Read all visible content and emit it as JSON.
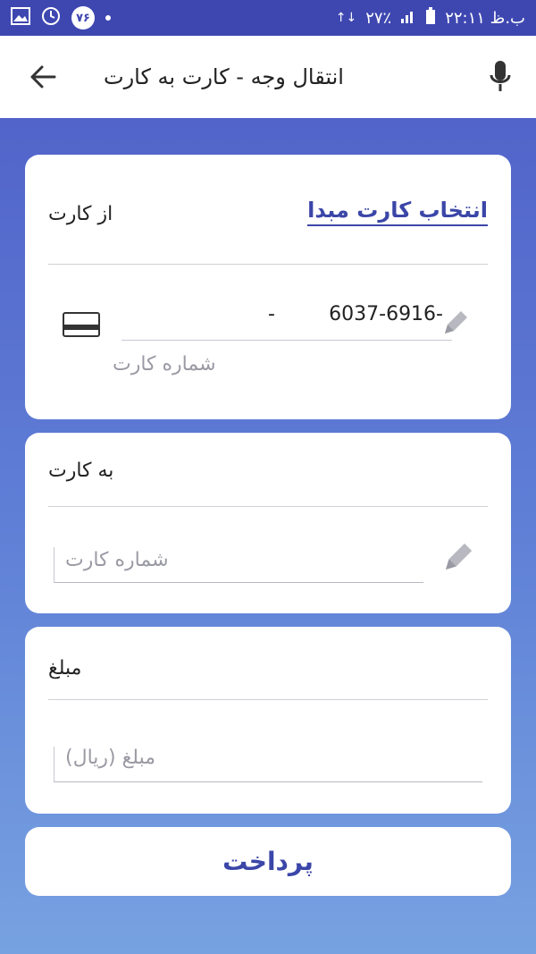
{
  "status_bar": {
    "left_time": "ب.ظ ۲۲:۱۱",
    "battery": "۲۷٪",
    "notification_badge": "۷۶"
  },
  "header": {
    "title": "انتقال وجه - کارت به کارت"
  },
  "card_source": {
    "label": "از کارت",
    "select_link": "انتخاب کارت مبدا",
    "number_left": "-",
    "number_right": "6037-6916-",
    "hint": "شماره کارت"
  },
  "card_dest": {
    "label": "به کارت",
    "placeholder": "شماره کارت"
  },
  "amount": {
    "label": "مبلغ",
    "placeholder": "مبلغ (ریال)"
  },
  "actions": {
    "submit_label": "پرداخت"
  },
  "colors": {
    "primary": "#3b46a8",
    "status_bar": "#3e47b0"
  }
}
